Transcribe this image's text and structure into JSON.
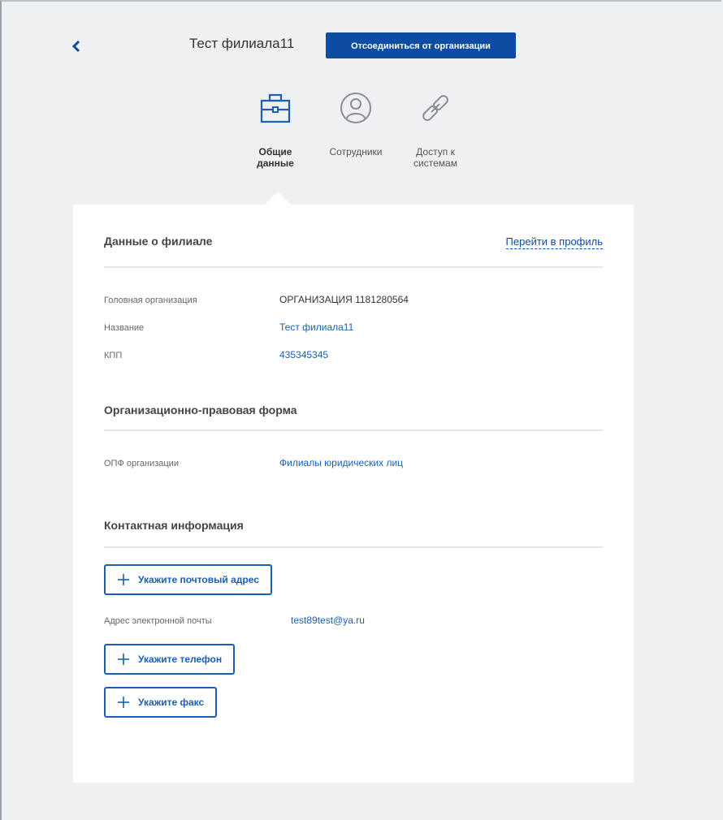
{
  "header": {
    "title": "Тест филиала11",
    "detach_button": "Отсоединиться от организации"
  },
  "tabs": [
    {
      "label": "Общие данные",
      "icon": "briefcase-icon",
      "active": true
    },
    {
      "label": "Сотрудники",
      "icon": "user-circle-icon",
      "active": false
    },
    {
      "label": "Доступ к системам",
      "icon": "link-icon",
      "active": false
    }
  ],
  "branch_section": {
    "title": "Данные о филиале",
    "profile_link": "Перейти в профиль",
    "rows": [
      {
        "label": "Головная организация",
        "value": "ОРГАНИЗАЦИЯ 1181280564"
      },
      {
        "label": "Название",
        "value": "Тест филиала11"
      },
      {
        "label": "КПП",
        "value": "435345345"
      }
    ]
  },
  "legal_section": {
    "title": "Организационно-правовая форма",
    "rows": [
      {
        "label": "ОПФ организации",
        "value": "Филиалы юридических лиц"
      }
    ]
  },
  "contact_section": {
    "title": "Контактная информация",
    "add_postal": "Укажите почтовый адрес",
    "email_label": "Адрес электронной почты",
    "email_value": "test89test@ya.ru",
    "add_phone": "Укажите телефон",
    "add_fax": "Укажите факс"
  },
  "colors": {
    "accent": "#0d4ca3",
    "link": "#1a5fb4",
    "background": "#eef0f2"
  }
}
